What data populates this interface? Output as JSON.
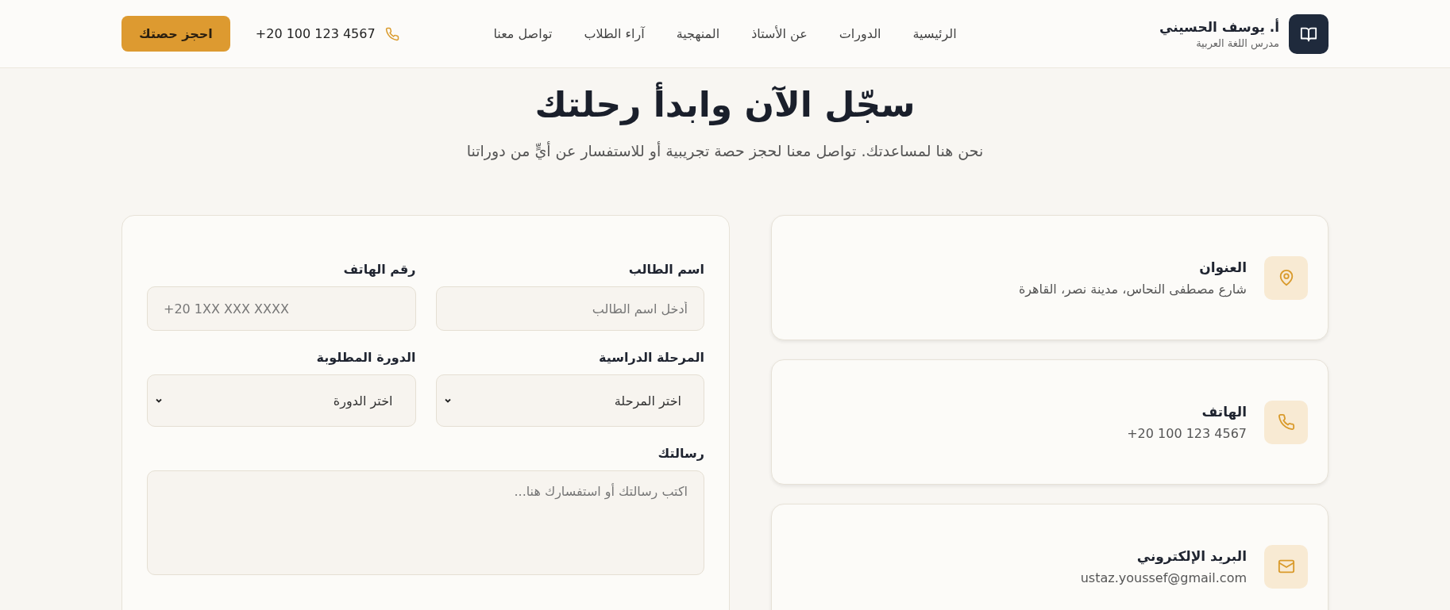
{
  "brand": {
    "name": "أ. يوسف الحسيني",
    "subtitle": "مدرس اللغة العربية"
  },
  "nav": [
    "الرئيسية",
    "الدورات",
    "عن الأستاذ",
    "المنهجية",
    "آراء الطلاب",
    "تواصل معنا"
  ],
  "header_phone": "+20 100 123 4567",
  "cta_button": "احجز حصتك",
  "heading": {
    "title": "سجّل الآن وابدأ رحلتك",
    "subtitle": "نحن هنا لمساعدتك. تواصل معنا لحجز حصة تجريبية أو للاستفسار عن أيٍّ من دوراتنا"
  },
  "form": {
    "fields": [
      {
        "kind": "input",
        "label": "اسم الطالب",
        "placeholder": "أدخل اسم الطالب"
      },
      {
        "kind": "phone",
        "label": "رقم الهاتف",
        "placeholder": "+20 1XX XXX XXXX"
      },
      {
        "kind": "select",
        "label": "المرحلة الدراسية",
        "value": "اختر المرحلة"
      },
      {
        "kind": "select",
        "label": "الدورة المطلوبة",
        "value": "اختر الدورة"
      },
      {
        "kind": "textarea",
        "label": "رسالتك",
        "placeholder": "اكتب رسالتك أو استفسارك هنا..."
      }
    ]
  },
  "contact_cards": [
    {
      "kind": "address",
      "title": "العنوان",
      "value": "شارع مصطفى النحاس، مدينة نصر، القاهرة"
    },
    {
      "kind": "phone",
      "title": "الهاتف",
      "value": "+20 100 123 4567"
    },
    {
      "kind": "email",
      "title": "البريد الإلكتروني",
      "value": "ustaz.youssef@gmail.com"
    }
  ]
}
